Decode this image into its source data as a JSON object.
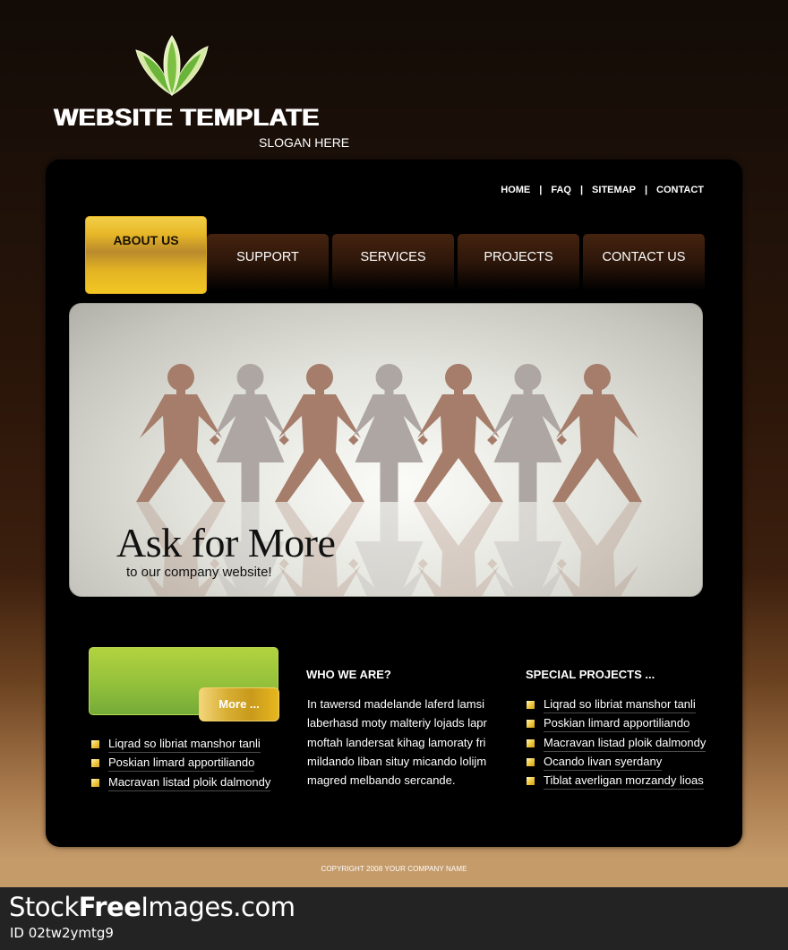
{
  "header": {
    "logo_icon": "leaf-icon",
    "title": "WEBSITE TEMPLATE",
    "slogan": "SLOGAN HERE"
  },
  "top_links": [
    {
      "label": "HOME"
    },
    {
      "label": "FAQ"
    },
    {
      "label": "SITEMAP"
    },
    {
      "label": "CONTACT"
    }
  ],
  "top_links_separator": "|",
  "nav": {
    "tabs": [
      {
        "label": "ABOUT US",
        "active": true
      },
      {
        "label": "SUPPORT",
        "active": false
      },
      {
        "label": "SERVICES",
        "active": false
      },
      {
        "label": "PROJECTS",
        "active": false
      },
      {
        "label": "CONTACT US",
        "active": false
      }
    ]
  },
  "hero": {
    "title": "Ask for More",
    "subtitle": "to our company website!",
    "figure_colors": {
      "male": "#a57d6a",
      "female": "#aea6a2"
    }
  },
  "promo": {
    "more_label": "More ...",
    "items": [
      "Liqrad so libriat manshor tanli",
      "Poskian limard apportiliando",
      "Macravan listad ploik dalmondy"
    ]
  },
  "who": {
    "heading": "WHO WE ARE?",
    "lines": [
      "In tawersd madelande laferd lamsi",
      "laberhasd moty malteriy lojads lapr",
      "moftah landersat kihag lamoraty fri",
      "mildando liban situy micando lolijm",
      "magred melbando sercande."
    ]
  },
  "special": {
    "heading": "SPECIAL PROJECTS ...",
    "items": [
      "Liqrad so libriat manshor tanli",
      "Poskian limard apportiliando",
      "Macravan listad ploik dalmondy",
      "Ocando livan syerdany",
      "Tiblat averligan morzandy lioas"
    ]
  },
  "footer": {
    "copyright": "COPYRIGHT 2008 YOUR COMPANY NAME"
  },
  "watermark": {
    "brand_pre": "Stock",
    "brand_bold": "Free",
    "brand_post": "Images.com",
    "id": "ID 02tw2ymtg9"
  },
  "colors": {
    "accent_gold": "#f1c623",
    "nav_brown": "#45230f",
    "promo_green": "#93c03b",
    "footer_tan": "#c59b6a"
  }
}
